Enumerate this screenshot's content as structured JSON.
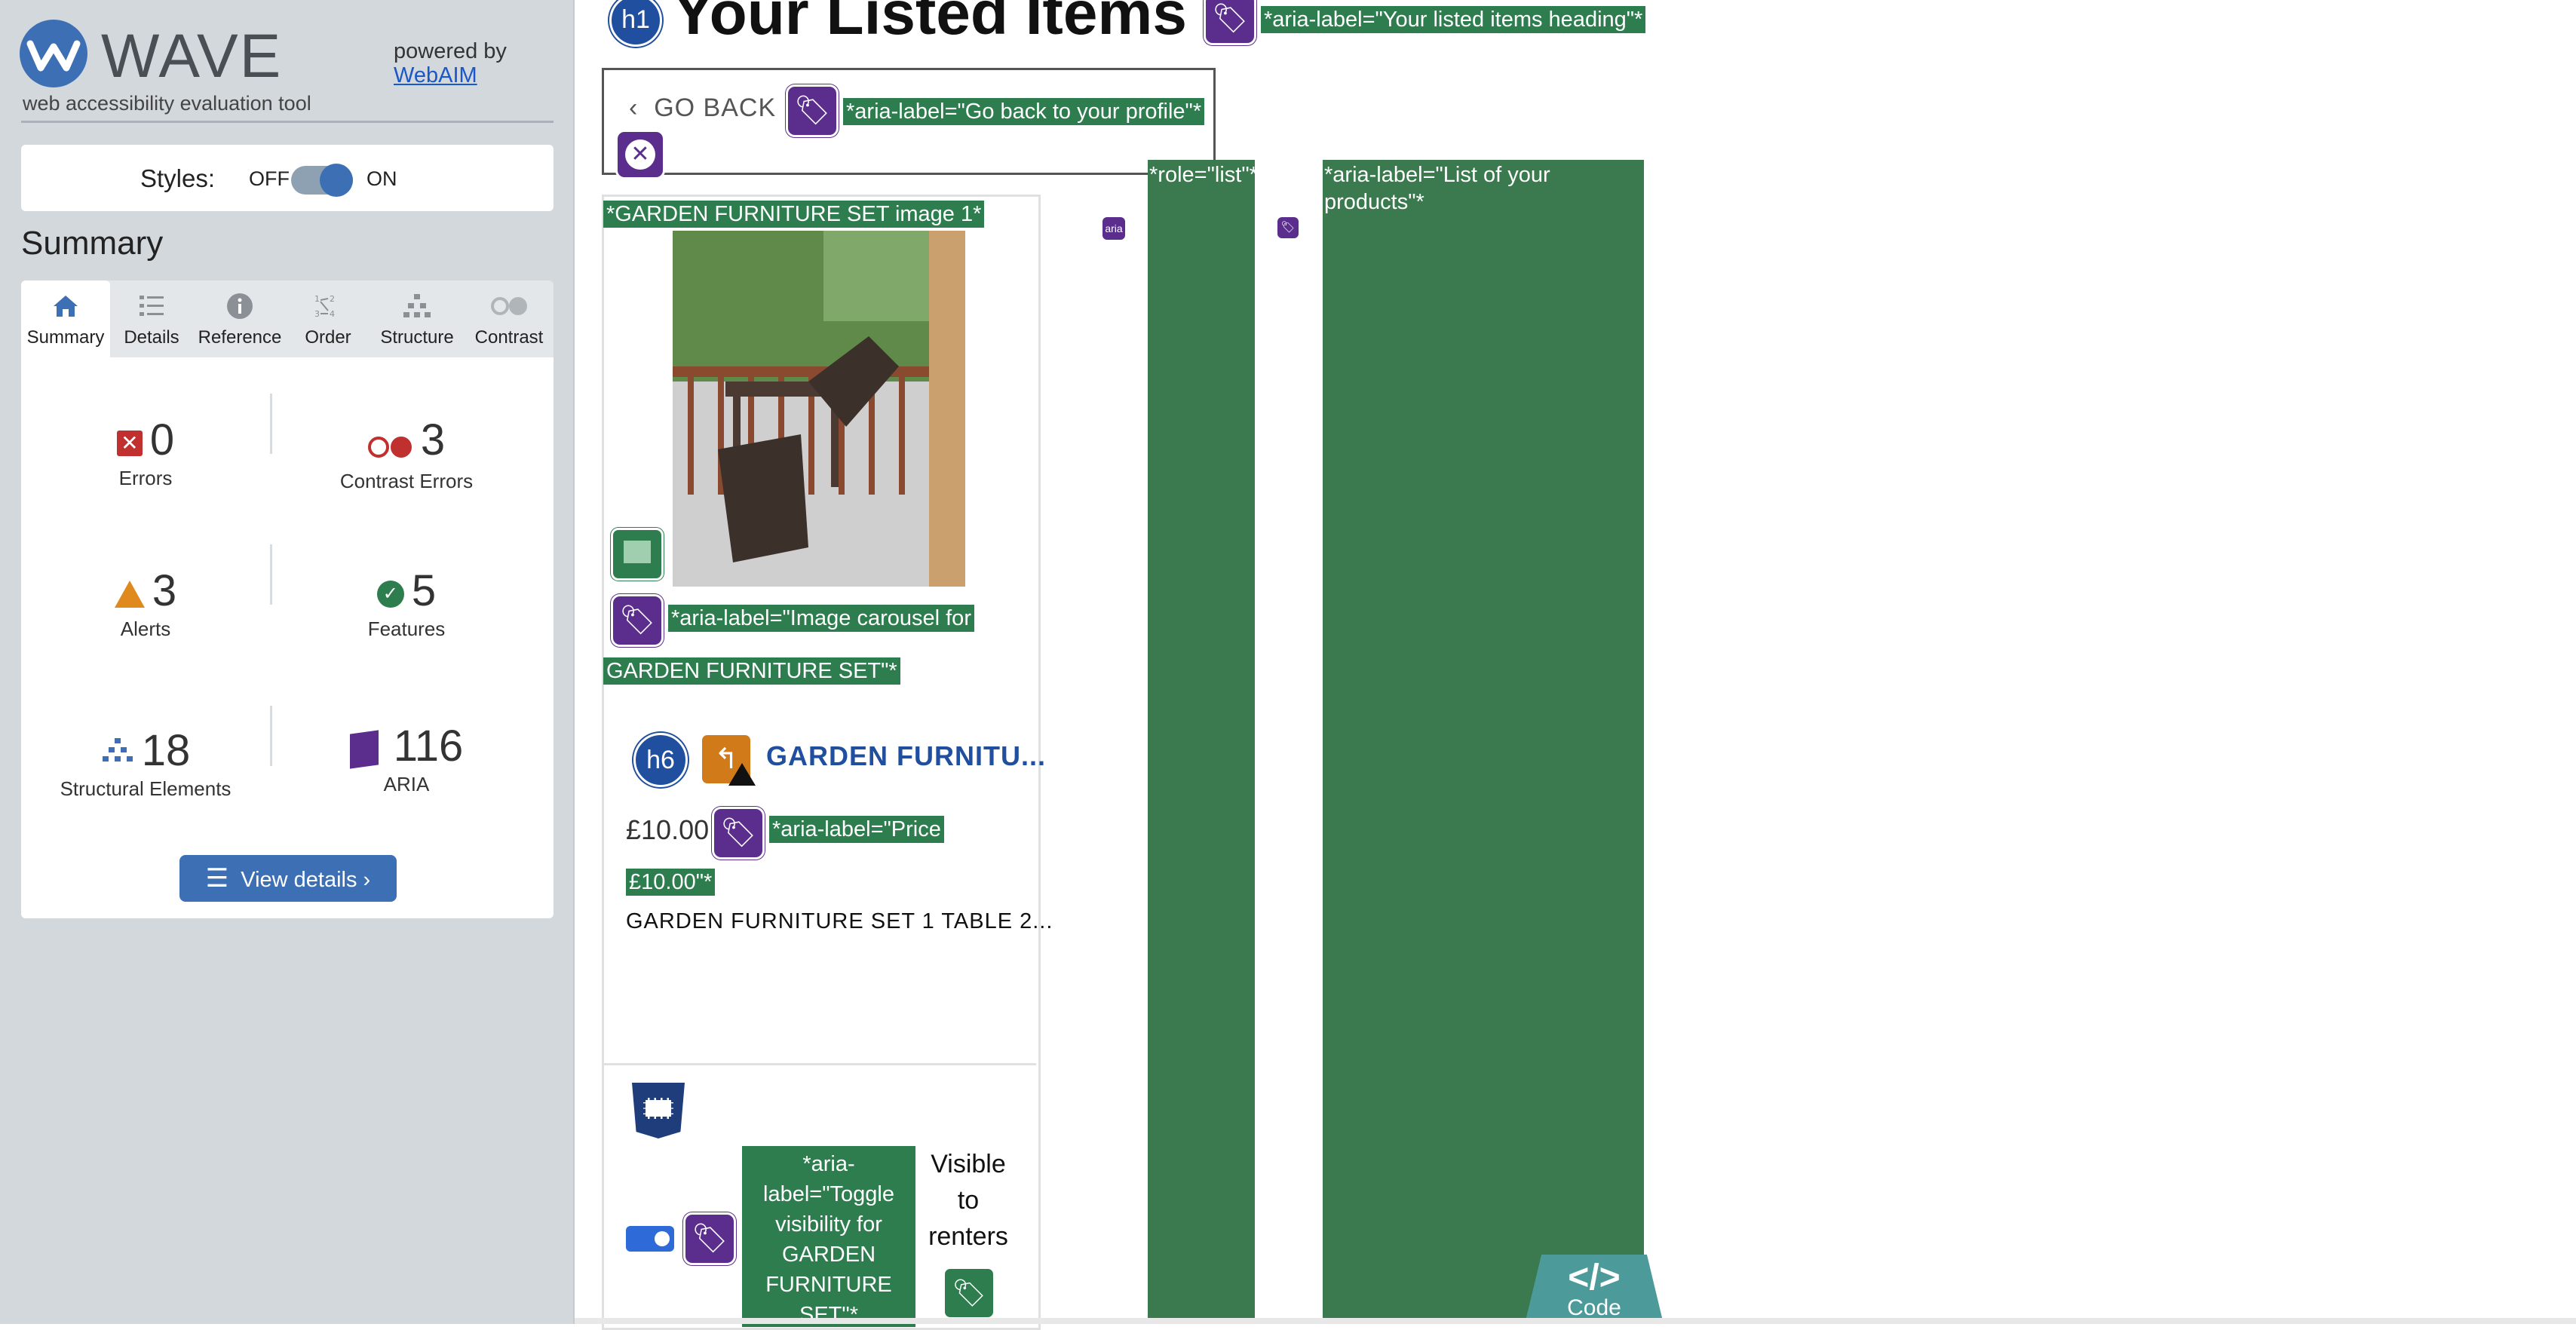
{
  "sidebar": {
    "logo_text": "WAVE",
    "logo_subtitle": "web accessibility evaluation tool",
    "powered_by": "powered by",
    "powered_link": "WebAIM",
    "styles_label": "Styles:",
    "styles_off": "OFF",
    "styles_on": "ON",
    "summary_title": "Summary",
    "tabs": [
      {
        "label": "Summary",
        "icon": "home-icon",
        "active": true
      },
      {
        "label": "Details",
        "icon": "list-icon",
        "active": false
      },
      {
        "label": "Reference",
        "icon": "info-icon",
        "active": false
      },
      {
        "label": "Order",
        "icon": "order-icon",
        "active": false
      },
      {
        "label": "Structure",
        "icon": "structure-icon",
        "active": false
      },
      {
        "label": "Contrast",
        "icon": "contrast-icon",
        "active": false
      }
    ],
    "stats": {
      "errors": {
        "value": "0",
        "label": "Errors"
      },
      "contrast_errors": {
        "value": "3",
        "label": "Contrast Errors"
      },
      "alerts": {
        "value": "3",
        "label": "Alerts"
      },
      "features": {
        "value": "5",
        "label": "Features"
      },
      "structural": {
        "value": "18",
        "label": "Structural Elements"
      },
      "aria": {
        "value": "116",
        "label": "ARIA"
      }
    },
    "view_details": "View details ›"
  },
  "page": {
    "h1_badge": "h1",
    "heading": "Your Listed Items",
    "heading_aria": "*aria-label=\"Your listed items heading\"*",
    "go_back": "GO BACK",
    "go_back_aria": "*aria-label=\"Go back to your profile\"*",
    "image_label": "*GARDEN FURNITURE SET image 1*",
    "carousel_aria_line1": "*aria-label=\"Image carousel for",
    "carousel_aria_line2": "GARDEN FURNITURE SET\"*",
    "h6_badge": "h6",
    "product_title": "GARDEN FURNITU...",
    "price": "£10.00",
    "price_aria_line1": "*aria-label=\"Price",
    "price_aria_line2": "£10.00\"*",
    "description": "GARDEN FURNITURE SET 1 TABLE 2...",
    "toggle_aria": "*aria-label=\"Toggle visibility for GARDEN FURNITURE SET\"*",
    "visible_text": "Visible to renters",
    "role_list": "*role=\"list\"*",
    "list_aria": "*aria-label=\"List of your products\"*",
    "aria_small": "aria",
    "code_glyph": "</>",
    "code_label": "Code"
  },
  "colors": {
    "wave_blue": "#3d6fb4",
    "aria_purple": "#5b2e8e",
    "feature_green": "#2e7d4f",
    "error_red": "#c0302e",
    "alert_orange": "#e08a1e"
  }
}
